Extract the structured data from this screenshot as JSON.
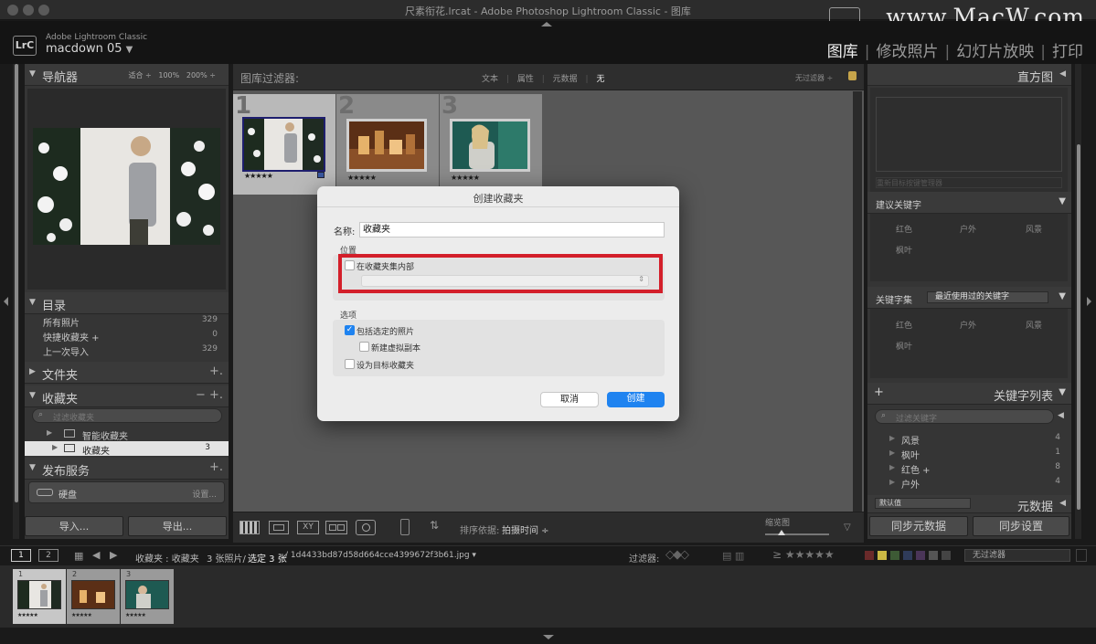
{
  "window": {
    "title": "尺素衔花.lrcat - Adobe Photoshop Lightroom Classic - 图库",
    "watermark": "www.MacW.com"
  },
  "header": {
    "app_label": "Adobe Lightroom Classic",
    "badge": "LrC",
    "catalog": "macdown 05",
    "modules": [
      "图库",
      "修改照片",
      "幻灯片放映",
      "打印"
    ],
    "active_module": "图库"
  },
  "navigator": {
    "title": "导航器",
    "zoom": [
      "适合",
      "100%",
      "200%"
    ]
  },
  "catalog": {
    "title": "目录",
    "items": [
      {
        "label": "所有照片",
        "count": "329"
      },
      {
        "label": "快捷收藏夹 +",
        "count": "0"
      },
      {
        "label": "上一次导入",
        "count": "329"
      }
    ]
  },
  "folders": {
    "title": "文件夹",
    "action": "+."
  },
  "collections": {
    "title": "收藏夹",
    "actions": "− +.",
    "search_placeholder": "过滤收藏夹",
    "items": [
      {
        "label": "智能收藏夹",
        "count": ""
      },
      {
        "label": "收藏夹",
        "count": "3"
      }
    ]
  },
  "publish": {
    "title": "发布服务",
    "action": "+.",
    "items": [
      {
        "label": "硬盘",
        "action": "设置..."
      }
    ]
  },
  "left_buttons": {
    "import": "导入...",
    "export": "导出..."
  },
  "filter_bar": {
    "label": "图库过滤器:",
    "options": [
      "文本",
      "属性",
      "元数据",
      "无"
    ],
    "preset": "无过滤器 ÷"
  },
  "grid": {
    "cells": [
      {
        "index": "1",
        "stars": "★★★★★",
        "selected": true
      },
      {
        "index": "2",
        "stars": "★★★★★",
        "selected": false
      },
      {
        "index": "3",
        "stars": "★★★★★",
        "selected": false
      }
    ]
  },
  "right_panel": {
    "histogram": "直方图",
    "histogram_placeholder": "重新目标按键管理器",
    "suggested": {
      "title": "建议关键字",
      "keywords": [
        "红色",
        "户外",
        "风景",
        "枫叶"
      ]
    },
    "keyword_set": {
      "title": "关键字集",
      "value": "最近使用过的关键字",
      "keywords": [
        "红色",
        "户外",
        "风景",
        "枫叶"
      ]
    },
    "keyword_list": {
      "title": "关键字列表",
      "search_placeholder": "过滤关键字",
      "items": [
        {
          "label": "风景",
          "count": "4"
        },
        {
          "label": "枫叶",
          "count": "1"
        },
        {
          "label": "红色 +",
          "count": "8"
        },
        {
          "label": "户外",
          "count": "4"
        }
      ]
    },
    "metadata": {
      "preset": "默认值",
      "title": "元数据"
    },
    "sync_metadata": "同步元数据",
    "sync_settings": "同步设置"
  },
  "toolbar": {
    "sort_label": "排序依据:",
    "sort_value": "拍摄时间 ÷",
    "thumb_label": "缩览图"
  },
  "bottom_bar": {
    "pages": [
      "1",
      "2"
    ],
    "source": "收藏夹 : 收藏夹",
    "count": "3 张照片/",
    "selected": "选定 3 张",
    "filename": "/ 1d4433bd87d58d664cce4399672f3b61.jpg ▾",
    "filter_label": "过滤器:",
    "filter_preset": "无过滤器"
  },
  "filmstrip": {
    "items": [
      {
        "index": "1",
        "stars": "★★★★★"
      },
      {
        "index": "2",
        "stars": "★★★★★"
      },
      {
        "index": "3",
        "stars": "★★★★★"
      }
    ]
  },
  "dialog": {
    "title": "创建收藏夹",
    "name_label": "名称:",
    "name_value": "收藏夹",
    "location_label": "位置",
    "inside_set_label": "在收藏夹集内部",
    "inside_set_checked": false,
    "options_label": "选项",
    "include_selected_label": "包括选定的照片",
    "include_selected_checked": true,
    "virtual_copies_label": "新建虚拟副本",
    "virtual_copies_checked": false,
    "target_label": "设为目标收藏夹",
    "target_checked": false,
    "cancel": "取消",
    "create": "创建"
  },
  "colors": {
    "highlight": "#d31f2a",
    "accent": "#1f83f0"
  }
}
